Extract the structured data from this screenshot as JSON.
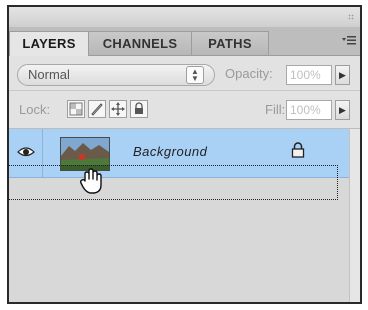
{
  "panel": {
    "tabs": [
      {
        "label": "LAYERS",
        "active": true
      },
      {
        "label": "CHANNELS",
        "active": false
      },
      {
        "label": "PATHS",
        "active": false
      }
    ],
    "menu_icon": "panel-menu-icon"
  },
  "blend": {
    "mode": "Normal",
    "opacity_label": "Opacity:",
    "opacity_value": "100%"
  },
  "lock": {
    "label": "Lock:",
    "fill_label": "Fill:",
    "fill_value": "100%",
    "buttons": [
      "lock-transparent-icon",
      "lock-image-icon",
      "lock-position-icon",
      "lock-all-icon"
    ]
  },
  "layers": [
    {
      "name": "Background",
      "visible": true,
      "locked": true,
      "selected": true
    }
  ],
  "colors": {
    "selection": "#a9d0f5",
    "panel_bg": "#dcdcdc"
  },
  "cursor": "hand-grab-icon"
}
